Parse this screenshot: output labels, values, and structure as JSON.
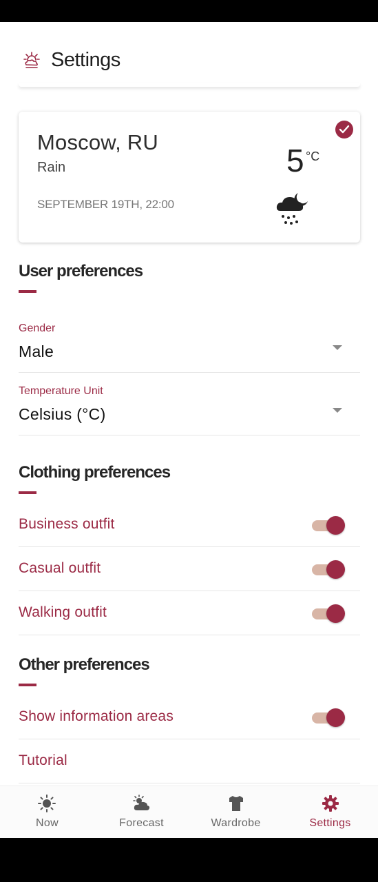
{
  "appbar": {
    "title": "Settings",
    "icon": "sun-cloud-icon"
  },
  "weather": {
    "city": "Moscow, RU",
    "condition": "Rain",
    "date": "SEPTEMBER 19TH, 22:00",
    "temperature": "5",
    "unit": "°C",
    "selected": true,
    "icon": "night-rain-icon"
  },
  "user_prefs": {
    "title": "User preferences",
    "gender": {
      "label": "Gender",
      "value": "Male"
    },
    "temp_unit": {
      "label": "Temperature Unit",
      "value": "Celsius (°C)"
    }
  },
  "clothing_prefs": {
    "title": "Clothing preferences",
    "items": [
      {
        "label": "Business outfit",
        "enabled": true
      },
      {
        "label": "Casual outfit",
        "enabled": true
      },
      {
        "label": "Walking outfit",
        "enabled": true
      }
    ]
  },
  "other_prefs": {
    "title": "Other preferences",
    "show_info": {
      "label": "Show information areas",
      "enabled": true
    },
    "tutorial": {
      "label": "Tutorial"
    }
  },
  "nav": {
    "items": [
      {
        "label": "Now",
        "icon": "sun-icon"
      },
      {
        "label": "Forecast",
        "icon": "cloud-sun-icon"
      },
      {
        "label": "Wardrobe",
        "icon": "tshirt-icon"
      },
      {
        "label": "Settings",
        "icon": "gear-icon",
        "active": true
      }
    ]
  },
  "colors": {
    "accent": "#9b2a45",
    "toggle_track": "#d8b5a6"
  }
}
